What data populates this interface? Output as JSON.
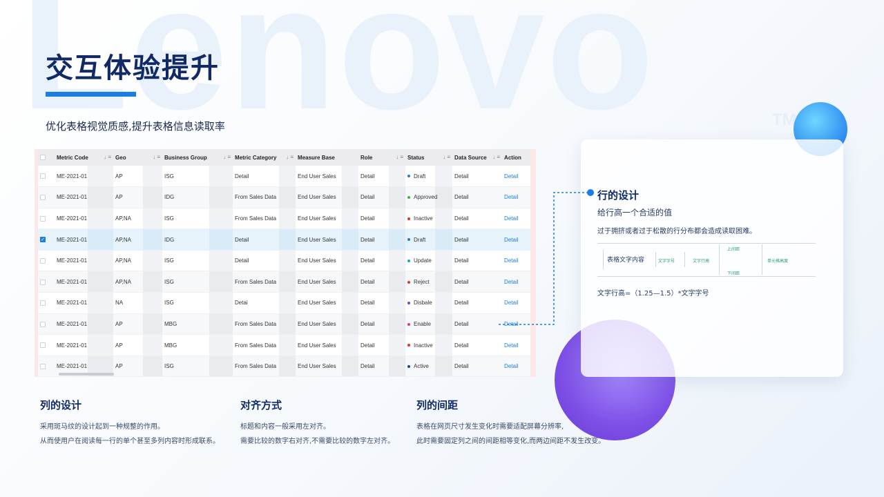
{
  "watermark": "Lenovo",
  "watermark_tm": "TM",
  "page": {
    "title": "交互体验提升",
    "subtitle": "优化表格视觉质感,提升表格信息读取率"
  },
  "colors": {
    "accent": "#1a7de3",
    "title": "#112a66"
  },
  "table": {
    "headers": [
      "Metric Code",
      "Geo",
      "Business Group",
      "Metric Category",
      "Measure Base",
      "Role",
      "Status",
      "Data Source",
      "Action"
    ],
    "rows": [
      {
        "code": "ME-2021-01",
        "geo": "AP",
        "bg": "ISG",
        "cat": "Detail",
        "base": "End User Sales",
        "role": "Detail",
        "status": "Draft",
        "status_color": "#1a7de3",
        "source": "Detail",
        "action": "Detail",
        "selected": false
      },
      {
        "code": "ME-2021-01",
        "geo": "AP",
        "bg": "IDG",
        "cat": "From Sales Data",
        "base": "End User Sales",
        "role": "Detail",
        "status": "Approved",
        "status_color": "#3cb34a",
        "source": "Detail",
        "action": "Detail",
        "selected": false
      },
      {
        "code": "ME-2021-01",
        "geo": "AP,NA",
        "bg": "ISG",
        "cat": "From Sales Data",
        "base": "End User Sales",
        "role": "Detail",
        "status": "Inactive",
        "status_color": "#e0322e",
        "source": "Detail",
        "action": "Detail",
        "selected": false
      },
      {
        "code": "ME-2021-01",
        "geo": "AP,NA",
        "bg": "IDG",
        "cat": "Detail",
        "base": "End User Sales",
        "role": "Detail",
        "status": "Draft",
        "status_color": "#1a7de3",
        "source": "Detail",
        "action": "Detail",
        "selected": true
      },
      {
        "code": "ME-2021-01",
        "geo": "AP,NA",
        "bg": "ISG",
        "cat": "Detail",
        "base": "End User Sales",
        "role": "Detail",
        "status": "Update",
        "status_color": "#1aa6b8",
        "source": "Detail",
        "action": "Detail",
        "selected": false
      },
      {
        "code": "ME-2021-01",
        "geo": "AP,NA",
        "bg": "ISG",
        "cat": "From Sales Data",
        "base": "End User Sales",
        "role": "Detail",
        "status": "Reject",
        "status_color": "#e0322e",
        "source": "Detail",
        "action": "Detail",
        "selected": false
      },
      {
        "code": "ME-2021-01",
        "geo": "NA",
        "bg": "ISG",
        "cat": "Detai",
        "base": "End User Sales",
        "role": "Detail",
        "status": "Disbale",
        "status_color": "#7a3fd6",
        "source": "Detail",
        "action": "Detail",
        "selected": false
      },
      {
        "code": "ME-2021-01",
        "geo": "AP",
        "bg": "MBG",
        "cat": "From Sales Data",
        "base": "End User Sales",
        "role": "Detail",
        "status": "Enable",
        "status_color": "#d63a8e",
        "source": "Detail",
        "action": "Detail",
        "selected": false
      },
      {
        "code": "ME-2021-01",
        "geo": "AP",
        "bg": "MBG",
        "cat": "From Sales Data",
        "base": "End User Sales",
        "role": "Detail",
        "status": "Inactive",
        "status_color": "#e0322e",
        "source": "Detail",
        "action": "Detail",
        "selected": false
      },
      {
        "code": "ME-2021-01",
        "geo": "AP",
        "bg": "ISG",
        "cat": "From Sales Data",
        "base": "End User Sales",
        "role": "Detail",
        "status": "Active",
        "status_color": "#1d3f9e",
        "source": "Detail",
        "action": "Detail",
        "selected": false
      }
    ]
  },
  "columns": [
    {
      "title": "列的设计",
      "lines": [
        "采用斑马纹的设计起到一种规整的作用。",
        "从而使用户在阅读每一行的单个甚至多列内容时形成联系。"
      ]
    },
    {
      "title": "对齐方式",
      "lines": [
        "标题和内容一般采用左对齐。",
        "需要比较的数字右对齐,不需要比较的数字左对齐。"
      ]
    },
    {
      "title": "列的间距",
      "lines": [
        "表格在网页尺寸发生变化时需要适配屏幕分辨率,",
        "此时需要固定列之间的间距相等变化,而两边间距不发生改变。"
      ]
    }
  ],
  "card": {
    "title": "行的设计",
    "subtitle": "给行高一个合适的值",
    "description": "过于拥挤或者过于松散的行分布都会造成读取困难。",
    "diagram": {
      "cell_text": "表格文字内容",
      "font_size": "文字字号",
      "line_height": "文字行高",
      "top_spacing": "上间距",
      "bottom_spacing": "下间距",
      "cell_height": "单元格高度"
    },
    "formula": "文字行高=（1.25—1.5）*文字字号"
  }
}
